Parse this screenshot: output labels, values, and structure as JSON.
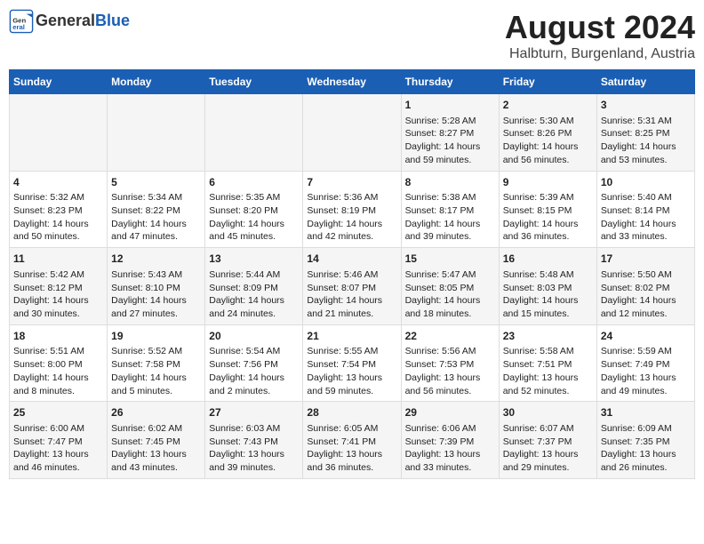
{
  "header": {
    "logo_general": "General",
    "logo_blue": "Blue",
    "title": "August 2024",
    "subtitle": "Halbturn, Burgenland, Austria"
  },
  "days_of_week": [
    "Sunday",
    "Monday",
    "Tuesday",
    "Wednesday",
    "Thursday",
    "Friday",
    "Saturday"
  ],
  "weeks": [
    [
      {
        "day": "",
        "content": ""
      },
      {
        "day": "",
        "content": ""
      },
      {
        "day": "",
        "content": ""
      },
      {
        "day": "",
        "content": ""
      },
      {
        "day": "1",
        "content": "Sunrise: 5:28 AM\nSunset: 8:27 PM\nDaylight: 14 hours\nand 59 minutes."
      },
      {
        "day": "2",
        "content": "Sunrise: 5:30 AM\nSunset: 8:26 PM\nDaylight: 14 hours\nand 56 minutes."
      },
      {
        "day": "3",
        "content": "Sunrise: 5:31 AM\nSunset: 8:25 PM\nDaylight: 14 hours\nand 53 minutes."
      }
    ],
    [
      {
        "day": "4",
        "content": "Sunrise: 5:32 AM\nSunset: 8:23 PM\nDaylight: 14 hours\nand 50 minutes."
      },
      {
        "day": "5",
        "content": "Sunrise: 5:34 AM\nSunset: 8:22 PM\nDaylight: 14 hours\nand 47 minutes."
      },
      {
        "day": "6",
        "content": "Sunrise: 5:35 AM\nSunset: 8:20 PM\nDaylight: 14 hours\nand 45 minutes."
      },
      {
        "day": "7",
        "content": "Sunrise: 5:36 AM\nSunset: 8:19 PM\nDaylight: 14 hours\nand 42 minutes."
      },
      {
        "day": "8",
        "content": "Sunrise: 5:38 AM\nSunset: 8:17 PM\nDaylight: 14 hours\nand 39 minutes."
      },
      {
        "day": "9",
        "content": "Sunrise: 5:39 AM\nSunset: 8:15 PM\nDaylight: 14 hours\nand 36 minutes."
      },
      {
        "day": "10",
        "content": "Sunrise: 5:40 AM\nSunset: 8:14 PM\nDaylight: 14 hours\nand 33 minutes."
      }
    ],
    [
      {
        "day": "11",
        "content": "Sunrise: 5:42 AM\nSunset: 8:12 PM\nDaylight: 14 hours\nand 30 minutes."
      },
      {
        "day": "12",
        "content": "Sunrise: 5:43 AM\nSunset: 8:10 PM\nDaylight: 14 hours\nand 27 minutes."
      },
      {
        "day": "13",
        "content": "Sunrise: 5:44 AM\nSunset: 8:09 PM\nDaylight: 14 hours\nand 24 minutes."
      },
      {
        "day": "14",
        "content": "Sunrise: 5:46 AM\nSunset: 8:07 PM\nDaylight: 14 hours\nand 21 minutes."
      },
      {
        "day": "15",
        "content": "Sunrise: 5:47 AM\nSunset: 8:05 PM\nDaylight: 14 hours\nand 18 minutes."
      },
      {
        "day": "16",
        "content": "Sunrise: 5:48 AM\nSunset: 8:03 PM\nDaylight: 14 hours\nand 15 minutes."
      },
      {
        "day": "17",
        "content": "Sunrise: 5:50 AM\nSunset: 8:02 PM\nDaylight: 14 hours\nand 12 minutes."
      }
    ],
    [
      {
        "day": "18",
        "content": "Sunrise: 5:51 AM\nSunset: 8:00 PM\nDaylight: 14 hours\nand 8 minutes."
      },
      {
        "day": "19",
        "content": "Sunrise: 5:52 AM\nSunset: 7:58 PM\nDaylight: 14 hours\nand 5 minutes."
      },
      {
        "day": "20",
        "content": "Sunrise: 5:54 AM\nSunset: 7:56 PM\nDaylight: 14 hours\nand 2 minutes."
      },
      {
        "day": "21",
        "content": "Sunrise: 5:55 AM\nSunset: 7:54 PM\nDaylight: 13 hours\nand 59 minutes."
      },
      {
        "day": "22",
        "content": "Sunrise: 5:56 AM\nSunset: 7:53 PM\nDaylight: 13 hours\nand 56 minutes."
      },
      {
        "day": "23",
        "content": "Sunrise: 5:58 AM\nSunset: 7:51 PM\nDaylight: 13 hours\nand 52 minutes."
      },
      {
        "day": "24",
        "content": "Sunrise: 5:59 AM\nSunset: 7:49 PM\nDaylight: 13 hours\nand 49 minutes."
      }
    ],
    [
      {
        "day": "25",
        "content": "Sunrise: 6:00 AM\nSunset: 7:47 PM\nDaylight: 13 hours\nand 46 minutes."
      },
      {
        "day": "26",
        "content": "Sunrise: 6:02 AM\nSunset: 7:45 PM\nDaylight: 13 hours\nand 43 minutes."
      },
      {
        "day": "27",
        "content": "Sunrise: 6:03 AM\nSunset: 7:43 PM\nDaylight: 13 hours\nand 39 minutes."
      },
      {
        "day": "28",
        "content": "Sunrise: 6:05 AM\nSunset: 7:41 PM\nDaylight: 13 hours\nand 36 minutes."
      },
      {
        "day": "29",
        "content": "Sunrise: 6:06 AM\nSunset: 7:39 PM\nDaylight: 13 hours\nand 33 minutes."
      },
      {
        "day": "30",
        "content": "Sunrise: 6:07 AM\nSunset: 7:37 PM\nDaylight: 13 hours\nand 29 minutes."
      },
      {
        "day": "31",
        "content": "Sunrise: 6:09 AM\nSunset: 7:35 PM\nDaylight: 13 hours\nand 26 minutes."
      }
    ]
  ]
}
